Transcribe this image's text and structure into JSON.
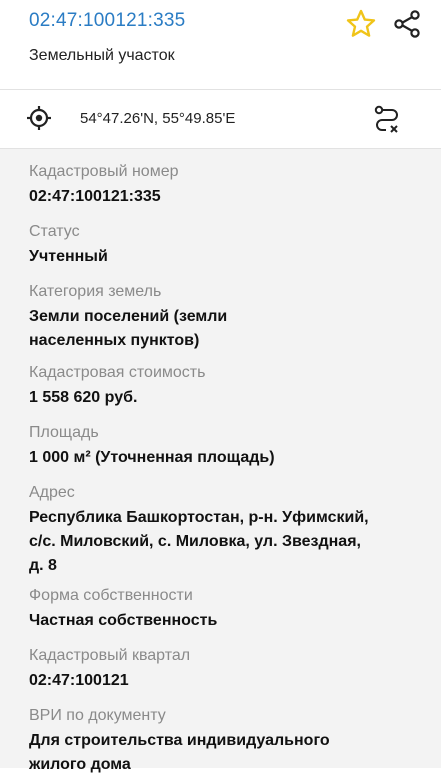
{
  "header": {
    "title": "02:47:100121:335",
    "subtitle": "Земельный участок",
    "star_icon": "star-outline-icon",
    "share_icon": "share-icon",
    "star_color": "#f0c419"
  },
  "coords_bar": {
    "coordinates": "54°47.26'N, 55°49.85'E",
    "locate_icon": "crosshair-icon",
    "route_icon": "route-clear-icon"
  },
  "details": [
    {
      "label": "Кадастровый номер",
      "lines": [
        "02:47:100121:335"
      ]
    },
    {
      "label": "Статус",
      "lines": [
        "Учтенный"
      ]
    },
    {
      "label": "Категория земель",
      "lines": [
        "Земли поселений (земли",
        "населенных пунктов)"
      ]
    },
    {
      "label": "Кадастровая стоимость",
      "lines": [
        "1 558 620 руб."
      ]
    },
    {
      "label": "Площадь",
      "lines": [
        "1 000 м² (Уточненная площадь)"
      ]
    },
    {
      "label": "Адрес",
      "lines": [
        "Республика Башкортостан, р-н. Уфимский,",
        "с/с. Миловский, с. Миловка, ул. Звездная,",
        "д. 8"
      ]
    },
    {
      "label": "Форма собственности",
      "lines": [
        "Частная собственность"
      ]
    },
    {
      "label": "Кадастровый квартал",
      "lines": [
        "02:47:100121"
      ]
    },
    {
      "label": "ВРИ по документу",
      "lines": [
        "Для строительства индивидуального",
        "жилого дома"
      ]
    }
  ]
}
